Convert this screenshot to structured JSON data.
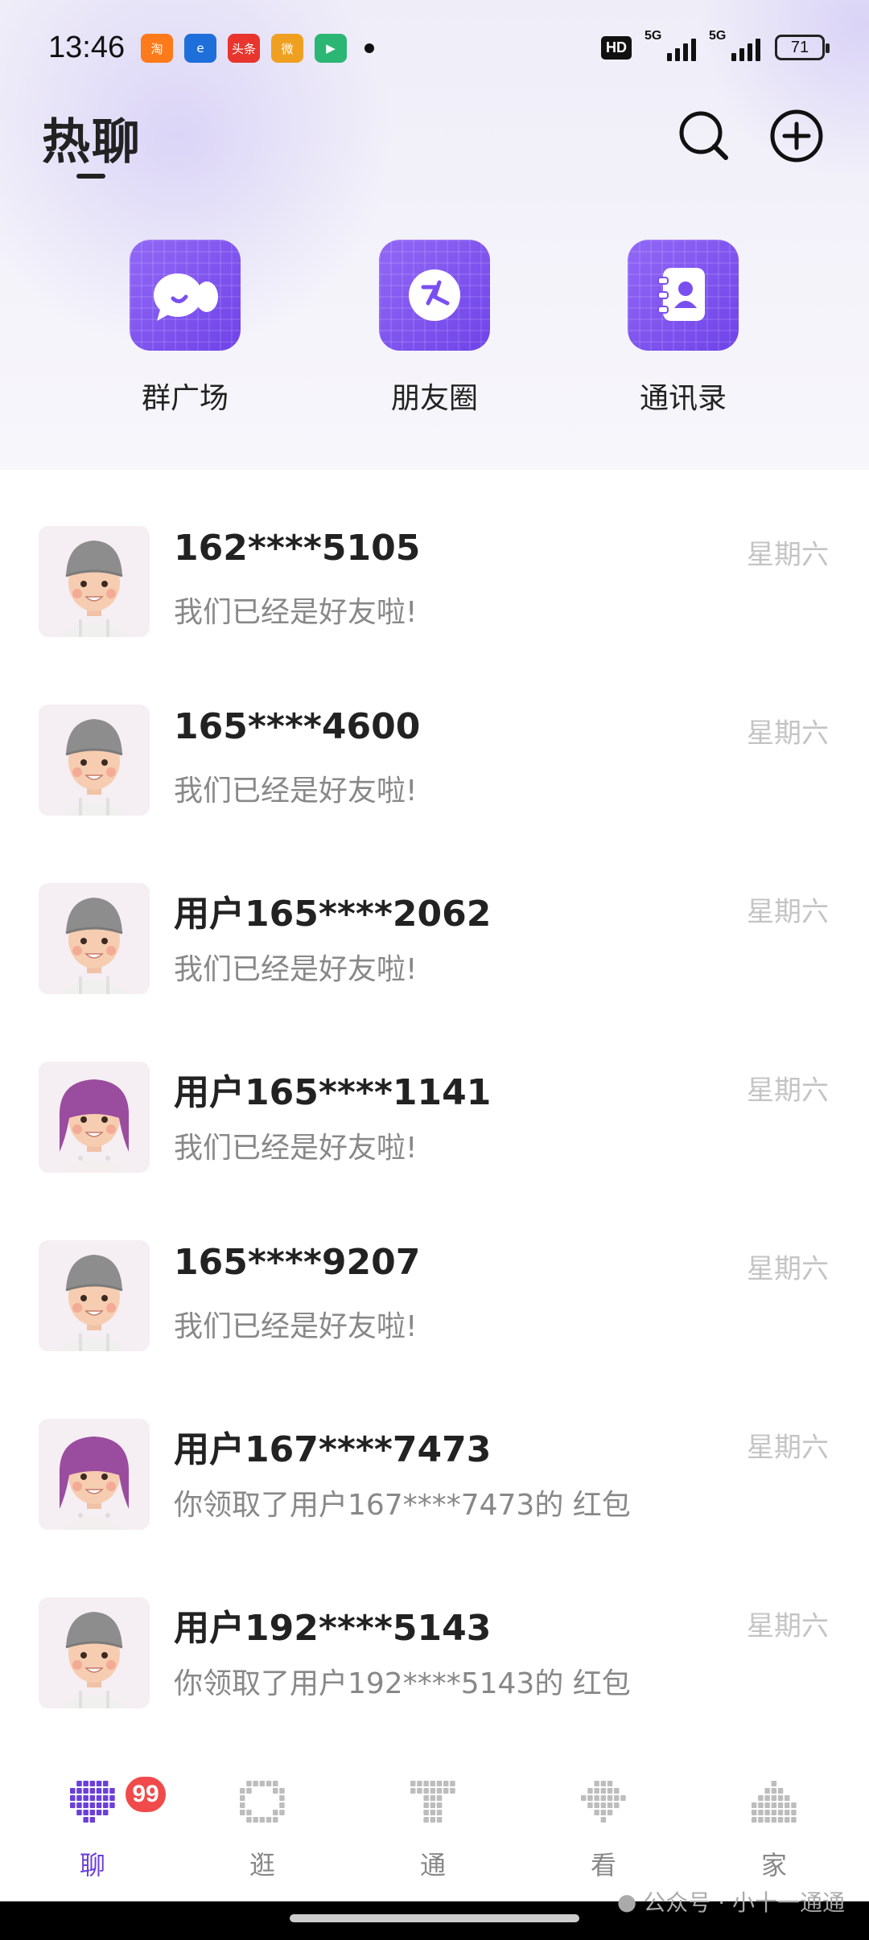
{
  "status_bar": {
    "time": "13:46",
    "app_icons": [
      {
        "name": "taobao-icon",
        "text": "淘",
        "color": "#ff7a1a"
      },
      {
        "name": "telecom-icon",
        "text": "e",
        "color": "#1e6fd9"
      },
      {
        "name": "toutiao-icon",
        "text": "头条",
        "color": "#e8352e"
      },
      {
        "name": "weibo-icon",
        "text": "微",
        "color": "#f0a020"
      },
      {
        "name": "video-app-icon",
        "text": "▶",
        "color": "#2bb673"
      }
    ],
    "hd_label": "HD",
    "signal_label_1": "5G",
    "signal_label_2": "5G",
    "battery": "71"
  },
  "header": {
    "title": "热聊",
    "shortcuts": [
      {
        "id": "group-square",
        "label": "群广场"
      },
      {
        "id": "moments",
        "label": "朋友圈"
      },
      {
        "id": "contacts",
        "label": "通讯录"
      }
    ]
  },
  "chats": [
    {
      "name": "",
      "preview": "我们已经是好友啦!",
      "time": "",
      "avatar": "boy"
    },
    {
      "name": "162****5105",
      "preview": "我们已经是好友啦!",
      "time": "星期六",
      "avatar": "boy"
    },
    {
      "name": "165****4600",
      "preview": "我们已经是好友啦!",
      "time": "星期六",
      "avatar": "boy"
    },
    {
      "name": "用户165****2062",
      "preview": "我们已经是好友啦!",
      "time": "星期六",
      "avatar": "boy"
    },
    {
      "name": "用户165****1141",
      "preview": "我们已经是好友啦!",
      "time": "星期六",
      "avatar": "girl"
    },
    {
      "name": "165****9207",
      "preview": "我们已经是好友啦!",
      "time": "星期六",
      "avatar": "boy"
    },
    {
      "name": "用户167****7473",
      "preview": "你领取了用户167****7473的 红包",
      "time": "星期六",
      "avatar": "girl"
    },
    {
      "name": "用户192****5143",
      "preview": "你领取了用户192****5143的 红包",
      "time": "星期六",
      "avatar": "boy"
    }
  ],
  "bottom_nav": {
    "items": [
      {
        "id": "chat",
        "label": "聊",
        "active": true
      },
      {
        "id": "browse",
        "label": "逛",
        "active": false
      },
      {
        "id": "connect",
        "label": "通",
        "active": false
      },
      {
        "id": "watch",
        "label": "看",
        "active": false
      },
      {
        "id": "home",
        "label": "家",
        "active": false
      }
    ],
    "badge": "99"
  },
  "watermark": "公众号 · 小十一通通",
  "colors": {
    "accent": "#6b3fd9",
    "tile": "#7a4ff0",
    "badge": "#f04a4a",
    "nav_inactive": "#bdbdbd"
  }
}
